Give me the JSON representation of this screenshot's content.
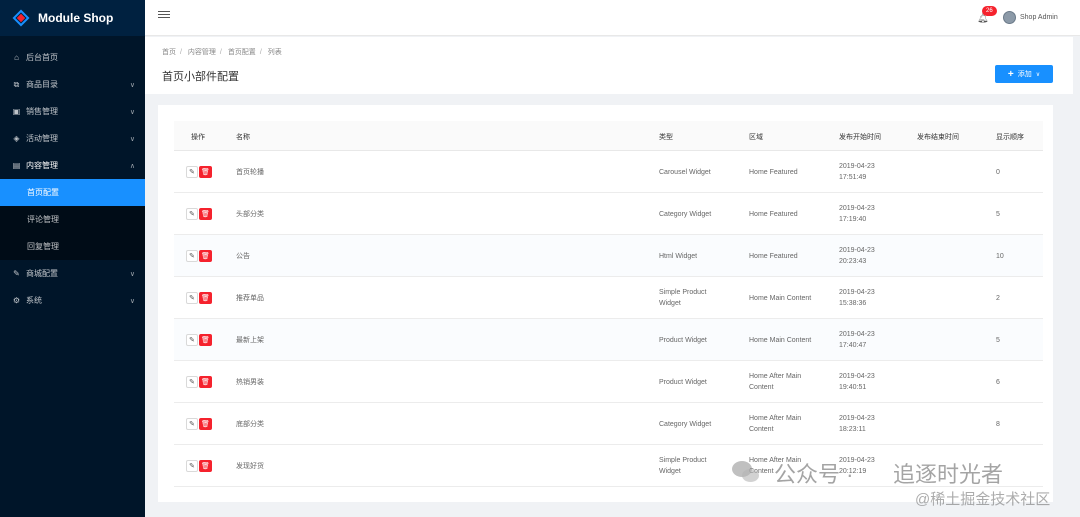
{
  "app": {
    "title": "Module Shop"
  },
  "sidebar": {
    "items": [
      {
        "label": "后台首页",
        "icon": "home-icon"
      },
      {
        "label": "商品目录",
        "icon": "sitemap-icon"
      },
      {
        "label": "销售管理",
        "icon": "cart-icon"
      },
      {
        "label": "活动管理",
        "icon": "tag-icon"
      },
      {
        "label": "内容管理",
        "icon": "content-icon"
      },
      {
        "label": "商城配置",
        "icon": "wrench-icon"
      },
      {
        "label": "系统",
        "icon": "system-icon"
      }
    ],
    "submenu": [
      {
        "label": "首页配置"
      },
      {
        "label": "评论管理"
      },
      {
        "label": "回复管理"
      }
    ]
  },
  "header": {
    "notification_count": "26",
    "username": "Shop Admin"
  },
  "breadcrumb": [
    "首页",
    "内容管理",
    "首页配置",
    "列表"
  ],
  "page_title": "首页小部件配置",
  "add_button": "添加",
  "table": {
    "columns": [
      "操作",
      "名称",
      "类型",
      "区域",
      "发布开始时间",
      "发布结束时间",
      "显示顺序"
    ],
    "rows": [
      {
        "name": "首页轮播",
        "type": [
          "Carousel Widget"
        ],
        "area": [
          "Home Featured"
        ],
        "date": "2019-04-23",
        "time": "17:51:49",
        "order": "0"
      },
      {
        "name": "头部分类",
        "type": [
          "Category Widget"
        ],
        "area": [
          "Home Featured"
        ],
        "date": "2019-04-23",
        "time": "17:19:40",
        "order": "5"
      },
      {
        "name": "公告",
        "type": [
          "Html Widget"
        ],
        "area": [
          "Home Featured"
        ],
        "date": "2019-04-23",
        "time": "20:23:43",
        "order": "10"
      },
      {
        "name": "推荐单品",
        "type": [
          "Simple Product",
          "Widget"
        ],
        "area": [
          "Home Main Content"
        ],
        "date": "2019-04-23",
        "time": "15:38:36",
        "order": "2"
      },
      {
        "name": "最新上架",
        "type": [
          "Product Widget"
        ],
        "area": [
          "Home Main Content"
        ],
        "date": "2019-04-23",
        "time": "17:40:47",
        "order": "5"
      },
      {
        "name": "热销男装",
        "type": [
          "Product Widget"
        ],
        "area": [
          "Home After Main",
          "Content"
        ],
        "date": "2019-04-23",
        "time": "19:40:51",
        "order": "6"
      },
      {
        "name": "底部分类",
        "type": [
          "Category Widget"
        ],
        "area": [
          "Home After Main",
          "Content"
        ],
        "date": "2019-04-23",
        "time": "18:23:11",
        "order": "8"
      },
      {
        "name": "发现好货",
        "type": [
          "Simple Product",
          "Widget"
        ],
        "area": [
          "Home After Main",
          "Content"
        ],
        "date": "2019-04-23",
        "time": "20:12:19",
        "order": ""
      }
    ]
  },
  "watermark": {
    "line1": "公众号 ·",
    "line2": "追逐时光者",
    "line3": "@稀土掘金技术社区"
  },
  "colors": {
    "sidebar": "#001529",
    "accent": "#1890ff",
    "danger": "#f5222d"
  }
}
